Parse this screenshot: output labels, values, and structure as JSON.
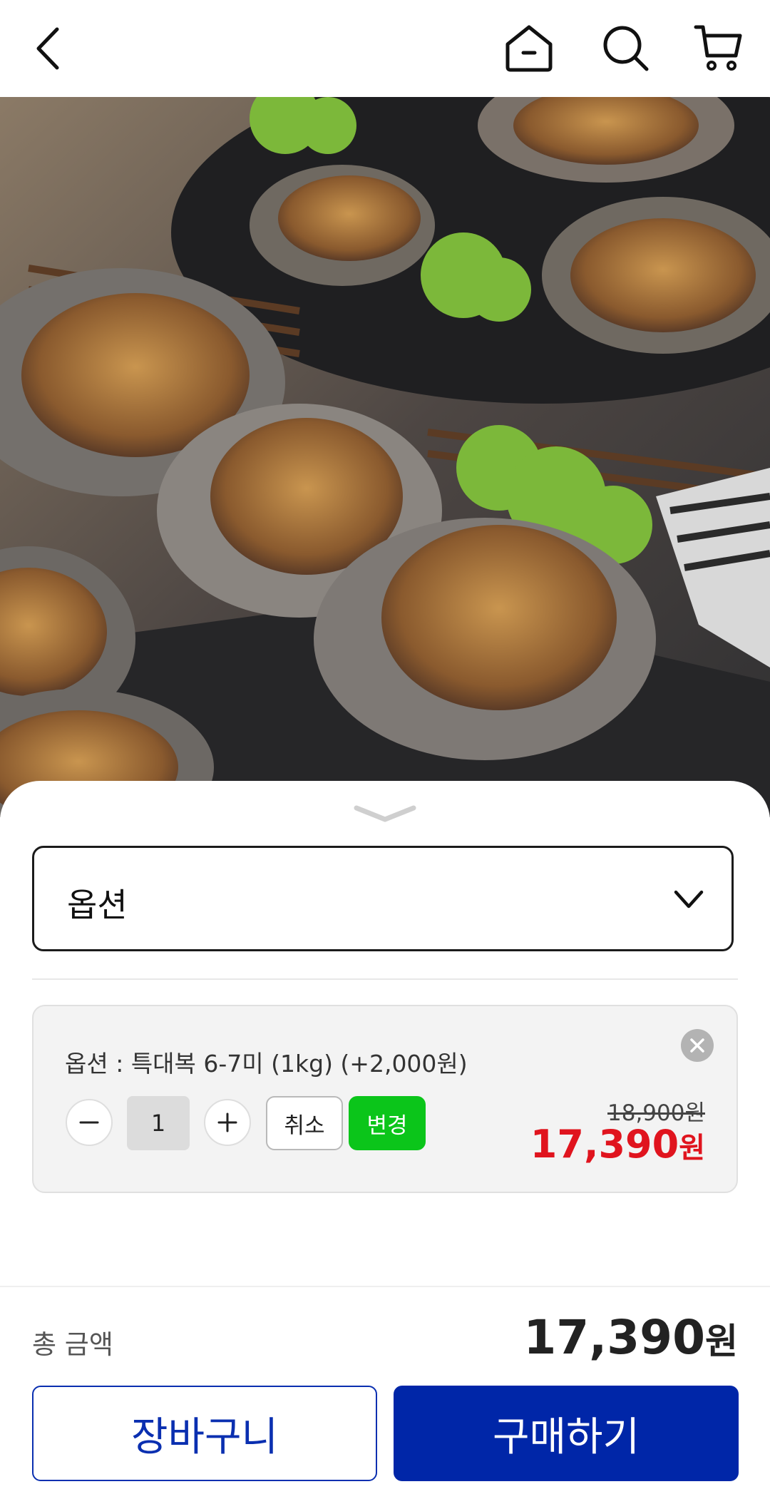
{
  "header": {
    "back_icon": "chevron-left-icon",
    "home_icon": "home-icon",
    "search_icon": "search-icon",
    "cart_icon": "cart-icon"
  },
  "hero": {
    "description_icon": "product-image"
  },
  "sheet": {
    "option_select": {
      "label": "옵션"
    },
    "selected_option": {
      "text": "옵션 : 특대복 6-7미 (1kg) (+2,000원)",
      "quantity": "1",
      "cancel_label": "취소",
      "change_label": "변경",
      "original_price": "18,900원",
      "sale_price_number": "17,390",
      "sale_price_unit": "원"
    },
    "total": {
      "label": "총 금액",
      "value_number": "17,390",
      "value_unit": "원"
    },
    "actions": {
      "cart_label": "장바구니",
      "buy_label": "구매하기"
    }
  },
  "colors": {
    "accent_blue": "#0026a8",
    "sale_red": "#e0141e",
    "change_green": "#0bc51a"
  }
}
